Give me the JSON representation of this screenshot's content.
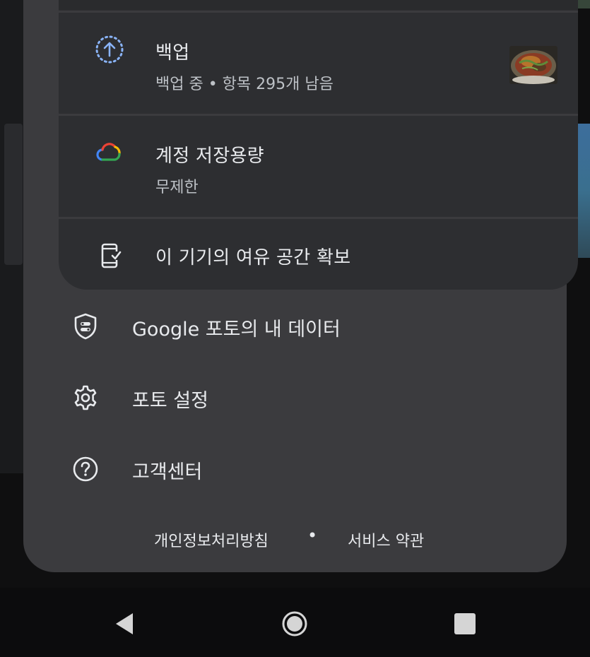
{
  "backup": {
    "title": "백업",
    "subtitle": "백업 중 • 항목 295개 남음",
    "icon": "backup-upload-icon"
  },
  "storage": {
    "title": "계정 저장용량",
    "subtitle": "무제한",
    "icon": "google-cloud-icon"
  },
  "free_space": {
    "title": "이 기기의 여유 공간 확보",
    "icon": "phone-check-icon"
  },
  "menu": [
    {
      "label": "Google 포토의 내 데이터",
      "icon": "shield-icon"
    },
    {
      "label": "포토 설정",
      "icon": "gear-icon"
    },
    {
      "label": "고객센터",
      "icon": "help-icon"
    }
  ],
  "footer": {
    "privacy": "개인정보처리방침",
    "separator": "•",
    "terms": "서비스 약관"
  },
  "colors": {
    "sheet_bg": "#3b3b3e",
    "card_bg": "#2d2e31",
    "backup_accent": "#8ab4f8"
  },
  "nav": [
    "back-icon",
    "home-icon",
    "recents-icon"
  ]
}
